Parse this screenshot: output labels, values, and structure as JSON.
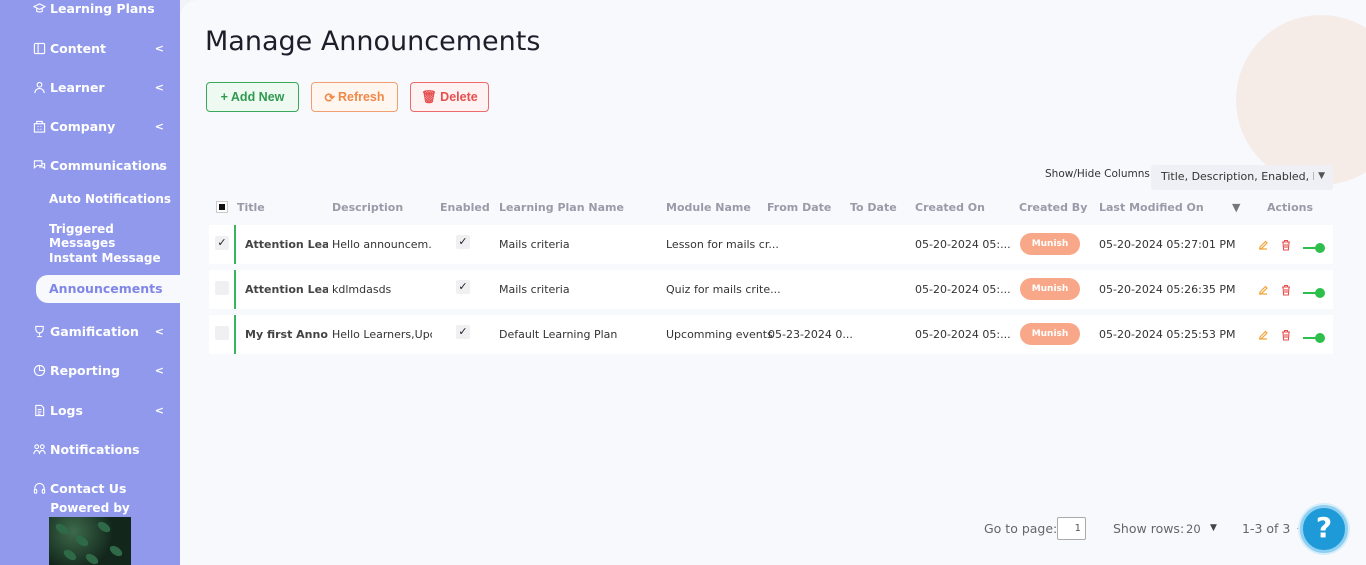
{
  "sidebar": {
    "items": [
      {
        "label": "Learning Plans",
        "icon": "learning-plans-icon",
        "chevron": ""
      },
      {
        "label": "Content",
        "icon": "content-icon",
        "chevron": "<"
      },
      {
        "label": "Learner",
        "icon": "learner-icon",
        "chevron": "<"
      },
      {
        "label": "Company",
        "icon": "company-icon",
        "chevron": "<"
      },
      {
        "label": "Communications",
        "icon": "communications-icon",
        "chevron": "⌄"
      },
      {
        "label": "Gamification",
        "icon": "gamification-icon",
        "chevron": "<"
      },
      {
        "label": "Reporting",
        "icon": "reporting-icon",
        "chevron": "<"
      },
      {
        "label": "Logs",
        "icon": "logs-icon",
        "chevron": "<"
      },
      {
        "label": "Notifications",
        "icon": "notifications-icon",
        "chevron": ""
      },
      {
        "label": "Contact Us",
        "icon": "contact-icon",
        "chevron": ""
      }
    ],
    "sub_items": [
      "Auto Notifications",
      "Triggered Messages",
      "Instant Message"
    ],
    "active_sub": "Announcements",
    "powered_by": "Powered by"
  },
  "main": {
    "title": "Manage Announcements",
    "buttons": {
      "add": "+ Add New",
      "refresh": "Refresh",
      "delete": "Delete"
    },
    "showhide_label": "Show/Hide Columns:",
    "showhide_value": "Title, Description, Enabled, L",
    "columns": [
      "Title",
      "Description",
      "Enabled",
      "Learning Plan Name",
      "Module Name",
      "From Date",
      "To Date",
      "Created On",
      "Created By",
      "Last Modified On",
      "Actions"
    ],
    "rows": [
      {
        "checked": "✓",
        "title": "Attention Learne",
        "description": "Hello announcem...",
        "enabled": "✓",
        "plan": "Mails criteria",
        "module": "Lesson for mails cr...",
        "from": "",
        "to": "",
        "created_on": "05-20-2024 05:...",
        "created_by": "Munish",
        "modified": "05-20-2024 05:27:01 PM"
      },
      {
        "checked": "",
        "title": "Attention Learne",
        "description": "kdlmdasds",
        "enabled": "✓",
        "plan": "Mails criteria",
        "module": "Quiz for mails crite...",
        "from": "",
        "to": "",
        "created_on": "05-20-2024 05:...",
        "created_by": "Munish",
        "modified": "05-20-2024 05:26:35 PM"
      },
      {
        "checked": "",
        "title": "My first Announc",
        "description": "Hello Learners,Upc...",
        "enabled": "✓",
        "plan": "Default Learning Plan",
        "module": "Upcomming events",
        "from": "05-23-2024 0...",
        "to": "",
        "created_on": "05-20-2024 05:...",
        "created_by": "Munish",
        "modified": "05-20-2024 05:25:53 PM"
      }
    ],
    "pager": {
      "goto_label": "Go to page:",
      "page_value": "1",
      "rows_label": "Show rows:",
      "rows_value": "20",
      "range": "1-3 of 3"
    },
    "help": "?"
  },
  "colors": {
    "sidebar": "#9199ec",
    "accent_green": "#3bb360",
    "badge": "#f8a888",
    "help": "#1f9ad8"
  }
}
